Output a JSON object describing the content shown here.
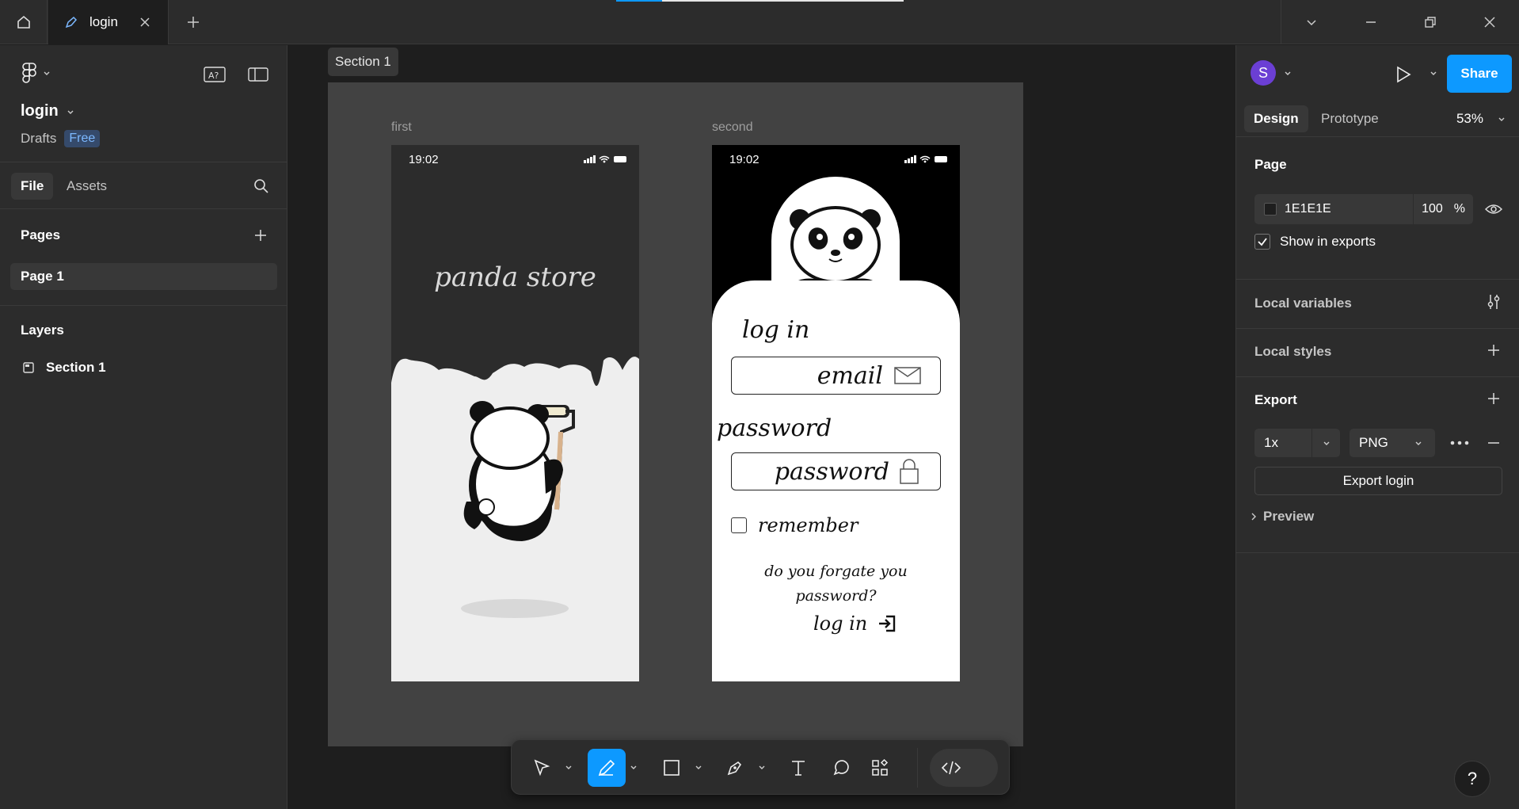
{
  "titlebar": {
    "tab_title": "login",
    "upload_progress": 0.16
  },
  "file": {
    "name": "login",
    "location": "Drafts",
    "plan_badge": "Free"
  },
  "left_tabs": [
    "File",
    "Assets"
  ],
  "pages": {
    "heading": "Pages",
    "items": [
      "Page 1"
    ]
  },
  "layers": {
    "heading": "Layers",
    "items": [
      "Section 1"
    ]
  },
  "canvas": {
    "section_label": "Section 1",
    "frames": [
      {
        "label": "first",
        "status_time": "19:02",
        "title": "panda store",
        "bg_top": "#2c2c2c",
        "bg_bottom": "#eeeeee"
      },
      {
        "label": "second",
        "status_time": "19:02",
        "heading": "log in",
        "email_placeholder": "email",
        "password_label": "password",
        "password_placeholder": "password",
        "remember_label": "remember",
        "forgot_text_1": "do you forgate you",
        "forgot_text_2": "password?",
        "login_link": "log in"
      }
    ]
  },
  "toolbar": {
    "tools": [
      "move-tool",
      "frame-tool",
      "shape-tool",
      "pen-tool",
      "text-tool",
      "comment-tool",
      "actions-tool",
      "dev-mode-toggle"
    ],
    "active_tool": "frame-tool"
  },
  "right_panel": {
    "avatar_initial": "S",
    "share_label": "Share",
    "tabs": [
      "Design",
      "Prototype"
    ],
    "zoom": "53%",
    "page_section": "Page",
    "page_color": "1E1E1E",
    "page_opacity": "100",
    "opacity_unit": "%",
    "show_in_exports": "Show in exports",
    "local_variables": "Local variables",
    "local_styles": "Local styles",
    "export_heading": "Export",
    "export_scale": "1x",
    "export_format": "PNG",
    "export_button": "Export login",
    "preview": "Preview",
    "help": "?"
  },
  "colors": {
    "accent": "#0d99ff",
    "panel": "#2c2c2c",
    "canvas": "#1e1e1e",
    "section": "#424242",
    "avatar": "#6b3fd4"
  }
}
